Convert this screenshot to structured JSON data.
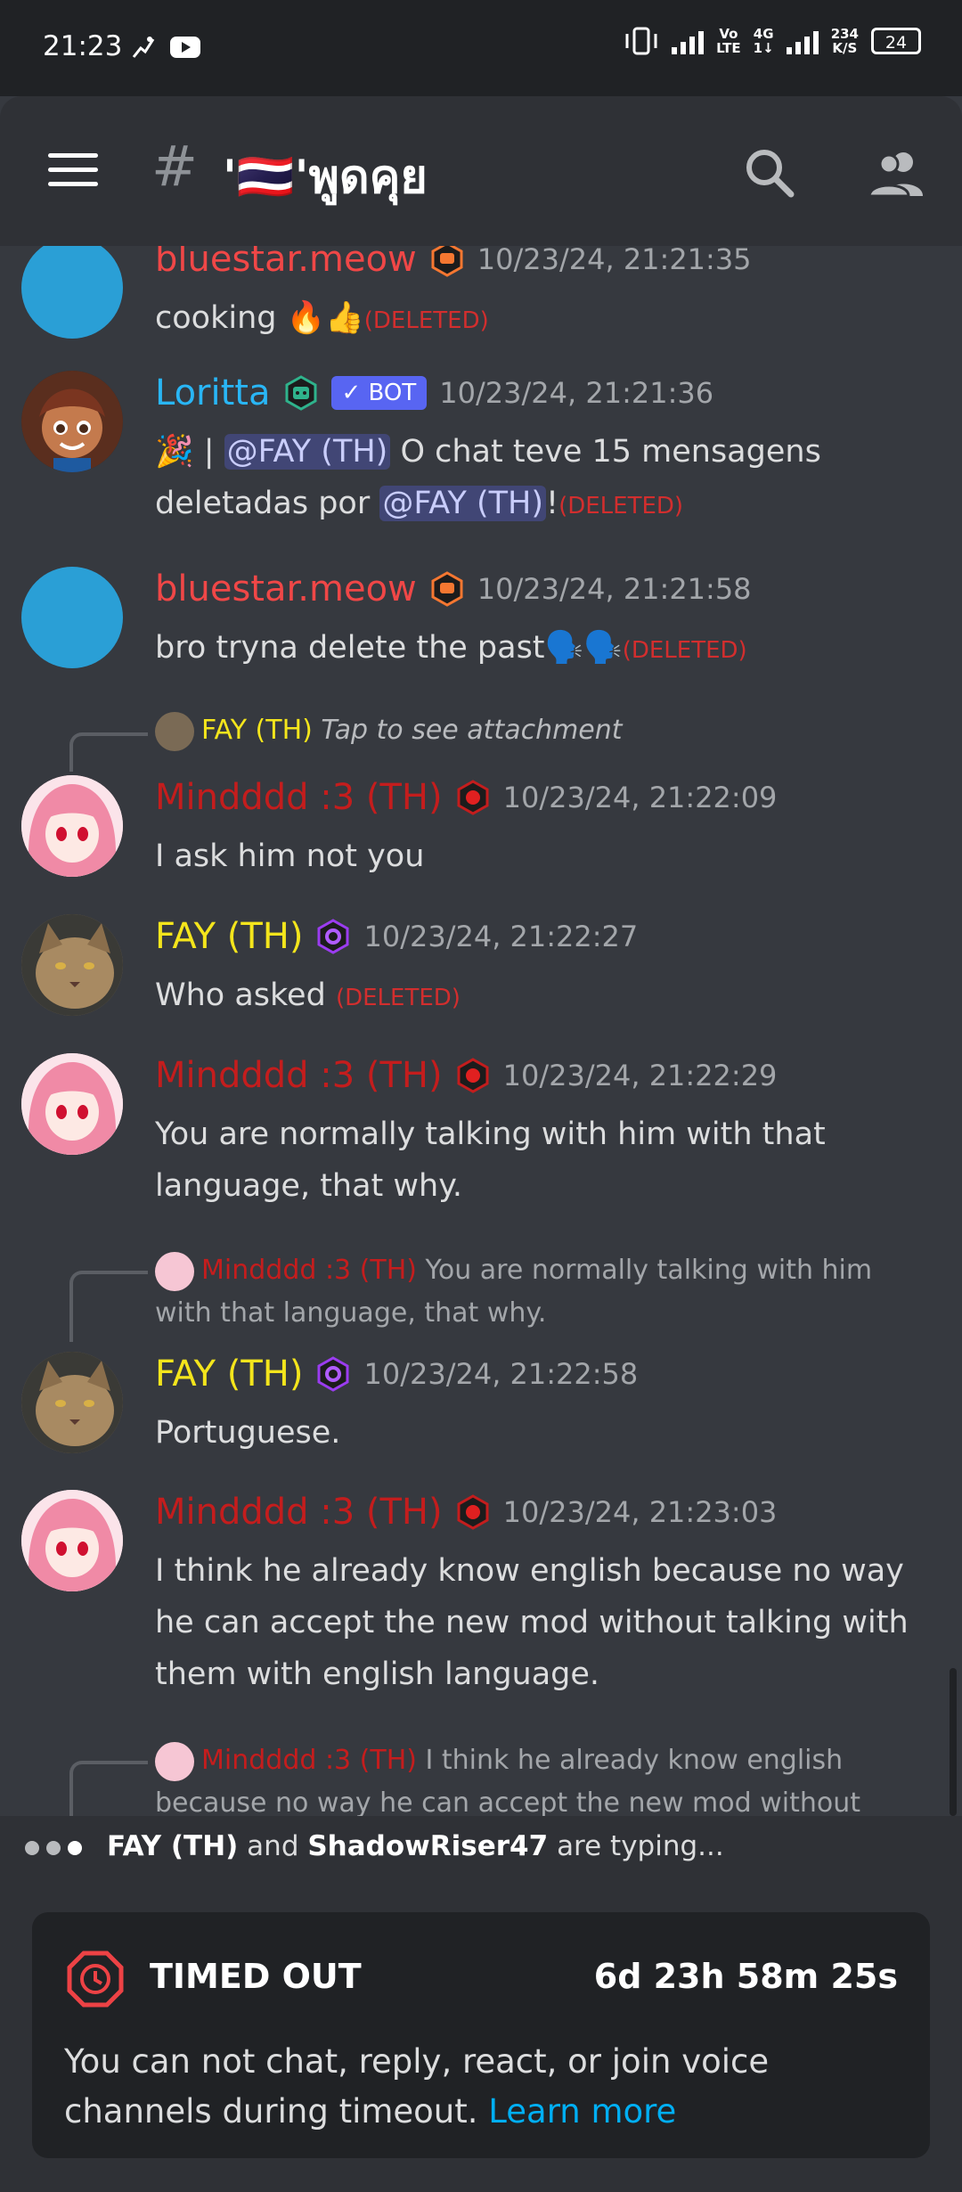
{
  "status_bar": {
    "time": "21:23",
    "net_top": "Vo",
    "net_bottom": "LTE",
    "g_top": "4G",
    "g_bottom": "1↓",
    "speed_top": "234",
    "speed_bottom": "K/S",
    "battery": "24"
  },
  "header": {
    "channel_name": "'🇹🇭'พูดคุย",
    "hash": "#"
  },
  "messages": [
    {
      "user": "bluestar.meow",
      "timestamp": "10/23/24, 21:21:35",
      "text": "cooking 🔥👍",
      "deleted": "(DELETED)"
    },
    {
      "user": "Loritta",
      "bot_label": "✓ BOT",
      "timestamp": "10/23/24, 21:21:36",
      "lead": "🎉 |",
      "mention1": "@FAY (TH)",
      "mid": "O chat teve 15 mensagens deletadas por",
      "mention2": "@FAY (TH)",
      "end": "!",
      "deleted": "(DELETED)"
    },
    {
      "user": "bluestar.meow",
      "timestamp": "10/23/24, 21:21:58",
      "text": "bro tryna delete the past🗣️🗣️",
      "deleted": "(DELETED)"
    },
    {
      "reply_user": "FAY (TH)",
      "reply_text": "Tap to see attachment",
      "user": "Mindddd :3 (TH)",
      "timestamp": "10/23/24, 21:22:09",
      "text": "I ask him not you"
    },
    {
      "user": "FAY (TH)",
      "timestamp": "10/23/24, 21:22:27",
      "text": "Who asked",
      "deleted": "(DELETED)"
    },
    {
      "user": "Mindddd :3 (TH)",
      "timestamp": "10/23/24, 21:22:29",
      "text": "You are normally talking with him with that language, that why."
    },
    {
      "reply_user": "Mindddd :3 (TH)",
      "reply_text": "You are normally talking with him with that language, that why.",
      "user": "FAY (TH)",
      "timestamp": "10/23/24, 21:22:58",
      "text": "Portuguese."
    },
    {
      "user": "Mindddd :3 (TH)",
      "timestamp": "10/23/24, 21:23:03",
      "text": "I think he already know english because no way he can accept the new mod without talking with them with english language."
    },
    {
      "reply_user": "Mindddd :3 (TH)",
      "reply_text": "I think he already know english because no way he can accept the new mod without"
    }
  ],
  "typing": {
    "user1": "FAY (TH)",
    "and": "and",
    "user2": "ShadowRiser47",
    "suffix": "are typing..."
  },
  "timeout": {
    "title": "TIMED OUT",
    "remaining": "6d 23h 58m 25s",
    "description": "You can not chat, reply, react, or join voice channels during timeout.",
    "link": "Learn more"
  },
  "colors": {
    "bluestar": "#f04747",
    "loritta": "#29b6f6",
    "mind": "#c41d1d",
    "fay": "#f4e51c",
    "link": "#00aff4"
  }
}
